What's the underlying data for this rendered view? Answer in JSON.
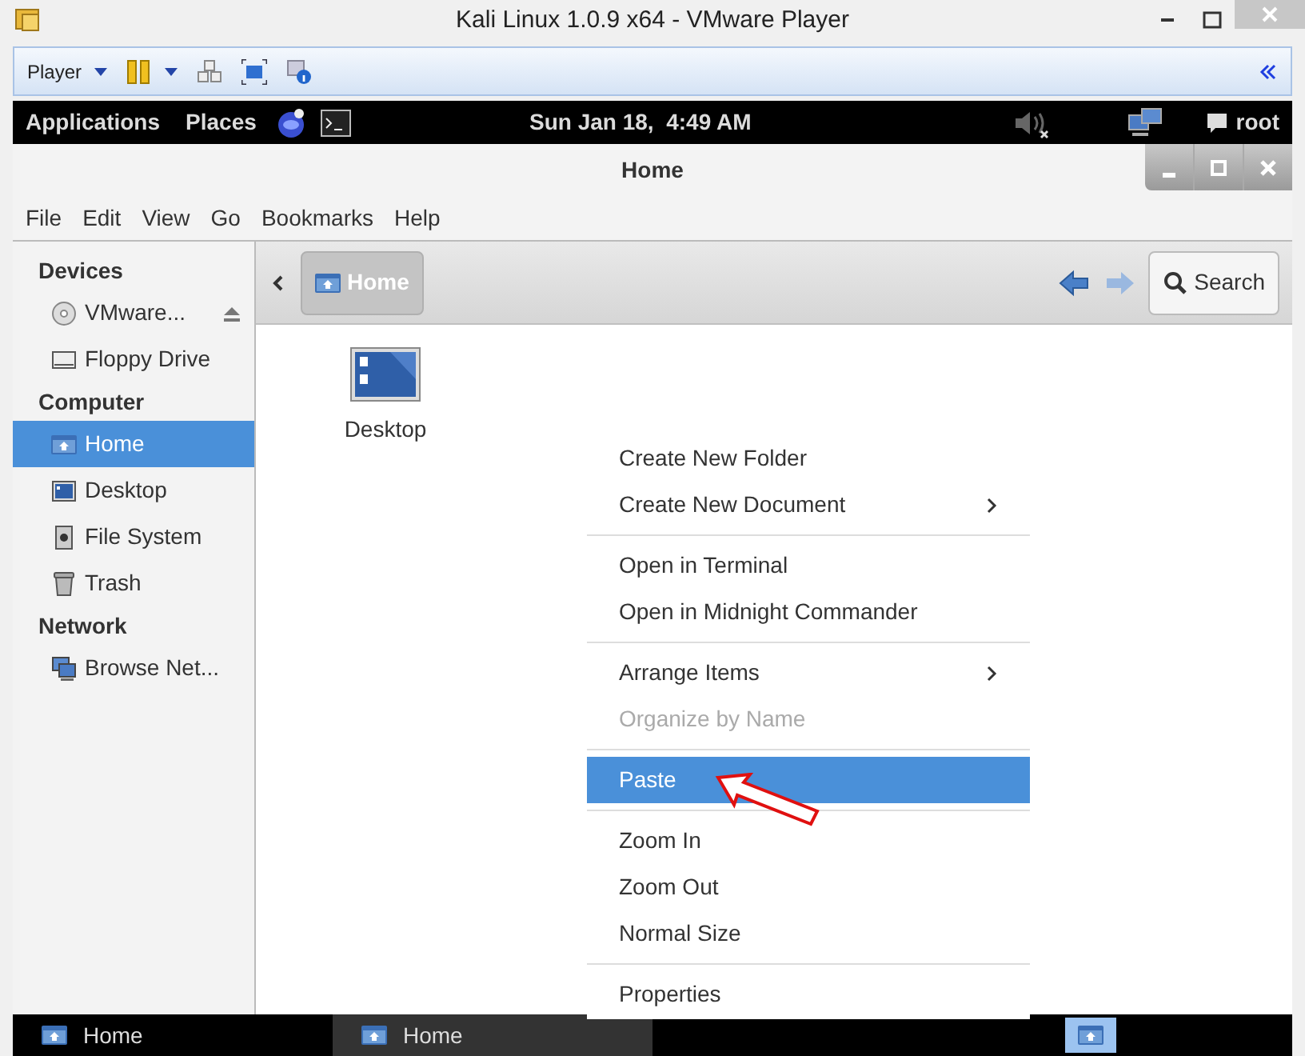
{
  "host_window": {
    "title": "Kali Linux 1.0.9 x64 - VMware Player"
  },
  "host_toolbar": {
    "player_menu": "Player"
  },
  "top_panel": {
    "menus": [
      "Applications",
      "Places"
    ],
    "clock": "Sun Jan 18,  4:49 AM",
    "user": "root"
  },
  "window": {
    "title": "Home"
  },
  "menubar": [
    "File",
    "Edit",
    "View",
    "Go",
    "Bookmarks",
    "Help"
  ],
  "sidebar": [
    {
      "heading": "Devices",
      "items": [
        {
          "label": "VMware...",
          "kind": "disc",
          "eject": true,
          "selected": false
        },
        {
          "label": "Floppy Drive",
          "kind": "floppy",
          "eject": false,
          "selected": false
        }
      ]
    },
    {
      "heading": "Computer",
      "items": [
        {
          "label": "Home",
          "kind": "home",
          "eject": false,
          "selected": true
        },
        {
          "label": "Desktop",
          "kind": "desktop",
          "eject": false,
          "selected": false
        },
        {
          "label": "File System",
          "kind": "drive",
          "eject": false,
          "selected": false
        },
        {
          "label": "Trash",
          "kind": "trash",
          "eject": false,
          "selected": false
        }
      ]
    },
    {
      "heading": "Network",
      "items": [
        {
          "label": "Browse Net...",
          "kind": "network",
          "eject": false,
          "selected": false
        }
      ]
    }
  ],
  "pathbar": {
    "crumb": "Home",
    "search": "Search"
  },
  "files": [
    {
      "name": "Desktop"
    }
  ],
  "context_menu": [
    {
      "kind": "item",
      "label": "Create New Folder",
      "submenu": false,
      "disabled": false,
      "selected": false
    },
    {
      "kind": "item",
      "label": "Create New Document",
      "submenu": true,
      "disabled": false,
      "selected": false
    },
    {
      "kind": "separator"
    },
    {
      "kind": "item",
      "label": "Open in Terminal",
      "submenu": false,
      "disabled": false,
      "selected": false
    },
    {
      "kind": "item",
      "label": "Open in Midnight Commander",
      "submenu": false,
      "disabled": false,
      "selected": false
    },
    {
      "kind": "separator"
    },
    {
      "kind": "item",
      "label": "Arrange Items",
      "submenu": true,
      "disabled": false,
      "selected": false
    },
    {
      "kind": "item",
      "label": "Organize by Name",
      "submenu": false,
      "disabled": true,
      "selected": false
    },
    {
      "kind": "separator"
    },
    {
      "kind": "item",
      "label": "Paste",
      "submenu": false,
      "disabled": false,
      "selected": true
    },
    {
      "kind": "separator"
    },
    {
      "kind": "item",
      "label": "Zoom In",
      "submenu": false,
      "disabled": false,
      "selected": false
    },
    {
      "kind": "item",
      "label": "Zoom Out",
      "submenu": false,
      "disabled": false,
      "selected": false
    },
    {
      "kind": "item",
      "label": "Normal Size",
      "submenu": false,
      "disabled": false,
      "selected": false
    },
    {
      "kind": "separator"
    },
    {
      "kind": "item",
      "label": "Properties",
      "submenu": false,
      "disabled": false,
      "selected": false
    }
  ],
  "taskbar": [
    {
      "label": "Home",
      "selected": false
    },
    {
      "label": "Home",
      "selected": true
    }
  ]
}
